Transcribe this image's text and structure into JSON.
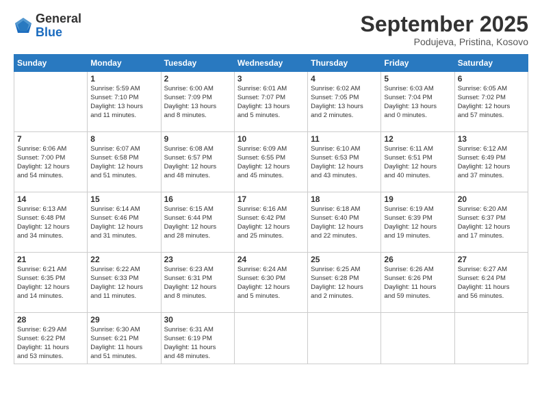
{
  "header": {
    "logo_general": "General",
    "logo_blue": "Blue",
    "month_title": "September 2025",
    "location": "Podujeva, Pristina, Kosovo"
  },
  "calendar": {
    "days_of_week": [
      "Sunday",
      "Monday",
      "Tuesday",
      "Wednesday",
      "Thursday",
      "Friday",
      "Saturday"
    ],
    "weeks": [
      [
        {
          "day": "",
          "info": ""
        },
        {
          "day": "1",
          "info": "Sunrise: 5:59 AM\nSunset: 7:10 PM\nDaylight: 13 hours\nand 11 minutes."
        },
        {
          "day": "2",
          "info": "Sunrise: 6:00 AM\nSunset: 7:09 PM\nDaylight: 13 hours\nand 8 minutes."
        },
        {
          "day": "3",
          "info": "Sunrise: 6:01 AM\nSunset: 7:07 PM\nDaylight: 13 hours\nand 5 minutes."
        },
        {
          "day": "4",
          "info": "Sunrise: 6:02 AM\nSunset: 7:05 PM\nDaylight: 13 hours\nand 2 minutes."
        },
        {
          "day": "5",
          "info": "Sunrise: 6:03 AM\nSunset: 7:04 PM\nDaylight: 13 hours\nand 0 minutes."
        },
        {
          "day": "6",
          "info": "Sunrise: 6:05 AM\nSunset: 7:02 PM\nDaylight: 12 hours\nand 57 minutes."
        }
      ],
      [
        {
          "day": "7",
          "info": "Sunrise: 6:06 AM\nSunset: 7:00 PM\nDaylight: 12 hours\nand 54 minutes."
        },
        {
          "day": "8",
          "info": "Sunrise: 6:07 AM\nSunset: 6:58 PM\nDaylight: 12 hours\nand 51 minutes."
        },
        {
          "day": "9",
          "info": "Sunrise: 6:08 AM\nSunset: 6:57 PM\nDaylight: 12 hours\nand 48 minutes."
        },
        {
          "day": "10",
          "info": "Sunrise: 6:09 AM\nSunset: 6:55 PM\nDaylight: 12 hours\nand 45 minutes."
        },
        {
          "day": "11",
          "info": "Sunrise: 6:10 AM\nSunset: 6:53 PM\nDaylight: 12 hours\nand 43 minutes."
        },
        {
          "day": "12",
          "info": "Sunrise: 6:11 AM\nSunset: 6:51 PM\nDaylight: 12 hours\nand 40 minutes."
        },
        {
          "day": "13",
          "info": "Sunrise: 6:12 AM\nSunset: 6:49 PM\nDaylight: 12 hours\nand 37 minutes."
        }
      ],
      [
        {
          "day": "14",
          "info": "Sunrise: 6:13 AM\nSunset: 6:48 PM\nDaylight: 12 hours\nand 34 minutes."
        },
        {
          "day": "15",
          "info": "Sunrise: 6:14 AM\nSunset: 6:46 PM\nDaylight: 12 hours\nand 31 minutes."
        },
        {
          "day": "16",
          "info": "Sunrise: 6:15 AM\nSunset: 6:44 PM\nDaylight: 12 hours\nand 28 minutes."
        },
        {
          "day": "17",
          "info": "Sunrise: 6:16 AM\nSunset: 6:42 PM\nDaylight: 12 hours\nand 25 minutes."
        },
        {
          "day": "18",
          "info": "Sunrise: 6:18 AM\nSunset: 6:40 PM\nDaylight: 12 hours\nand 22 minutes."
        },
        {
          "day": "19",
          "info": "Sunrise: 6:19 AM\nSunset: 6:39 PM\nDaylight: 12 hours\nand 19 minutes."
        },
        {
          "day": "20",
          "info": "Sunrise: 6:20 AM\nSunset: 6:37 PM\nDaylight: 12 hours\nand 17 minutes."
        }
      ],
      [
        {
          "day": "21",
          "info": "Sunrise: 6:21 AM\nSunset: 6:35 PM\nDaylight: 12 hours\nand 14 minutes."
        },
        {
          "day": "22",
          "info": "Sunrise: 6:22 AM\nSunset: 6:33 PM\nDaylight: 12 hours\nand 11 minutes."
        },
        {
          "day": "23",
          "info": "Sunrise: 6:23 AM\nSunset: 6:31 PM\nDaylight: 12 hours\nand 8 minutes."
        },
        {
          "day": "24",
          "info": "Sunrise: 6:24 AM\nSunset: 6:30 PM\nDaylight: 12 hours\nand 5 minutes."
        },
        {
          "day": "25",
          "info": "Sunrise: 6:25 AM\nSunset: 6:28 PM\nDaylight: 12 hours\nand 2 minutes."
        },
        {
          "day": "26",
          "info": "Sunrise: 6:26 AM\nSunset: 6:26 PM\nDaylight: 11 hours\nand 59 minutes."
        },
        {
          "day": "27",
          "info": "Sunrise: 6:27 AM\nSunset: 6:24 PM\nDaylight: 11 hours\nand 56 minutes."
        }
      ],
      [
        {
          "day": "28",
          "info": "Sunrise: 6:29 AM\nSunset: 6:22 PM\nDaylight: 11 hours\nand 53 minutes."
        },
        {
          "day": "29",
          "info": "Sunrise: 6:30 AM\nSunset: 6:21 PM\nDaylight: 11 hours\nand 51 minutes."
        },
        {
          "day": "30",
          "info": "Sunrise: 6:31 AM\nSunset: 6:19 PM\nDaylight: 11 hours\nand 48 minutes."
        },
        {
          "day": "",
          "info": ""
        },
        {
          "day": "",
          "info": ""
        },
        {
          "day": "",
          "info": ""
        },
        {
          "day": "",
          "info": ""
        }
      ]
    ]
  }
}
